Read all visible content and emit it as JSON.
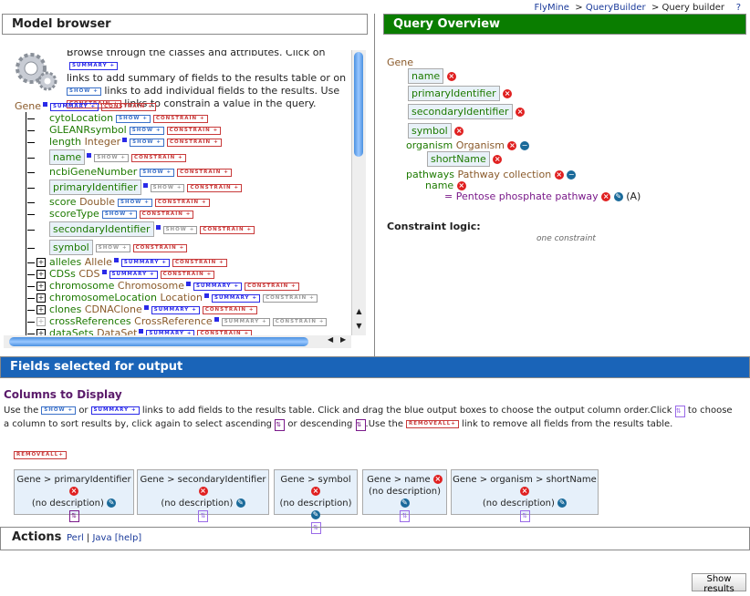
{
  "breadcrumb": {
    "items": [
      "FlyMine",
      "QueryBuilder",
      "Query builder"
    ],
    "sep": ">",
    "help": "?"
  },
  "model_browser": {
    "title": "Model browser",
    "intro": [
      "Browse through the classes and attributes. Click on",
      "links to add summary of fields to the results table or on",
      "links to add individual fields to the results. Use",
      "links to constrain a value in the query."
    ],
    "root": "Gene",
    "badges": {
      "summary": "SUMMARY +",
      "show": "SHOW +",
      "constrain": "CONSTRAIN +"
    },
    "items": [
      {
        "name": "cytoLocation",
        "type": "",
        "info": false,
        "boxed": false,
        "link": "show",
        "state": "on",
        "con": "on",
        "exp": ""
      },
      {
        "name": "GLEANRsymbol",
        "type": "",
        "info": false,
        "boxed": false,
        "link": "show",
        "state": "on",
        "con": "on",
        "exp": ""
      },
      {
        "name": "length",
        "type": "Integer",
        "info": true,
        "boxed": false,
        "link": "show",
        "state": "on",
        "con": "on",
        "exp": ""
      },
      {
        "name": "name",
        "type": "",
        "info": true,
        "boxed": true,
        "link": "show",
        "state": "off",
        "con": "on",
        "exp": ""
      },
      {
        "name": "ncbiGeneNumber",
        "type": "",
        "info": false,
        "boxed": false,
        "link": "show",
        "state": "on",
        "con": "on",
        "exp": ""
      },
      {
        "name": "primaryIdentifier",
        "type": "",
        "info": true,
        "boxed": true,
        "link": "show",
        "state": "off",
        "con": "on",
        "exp": ""
      },
      {
        "name": "score",
        "type": "Double",
        "info": false,
        "boxed": false,
        "link": "show",
        "state": "on",
        "con": "on",
        "exp": ""
      },
      {
        "name": "scoreType",
        "type": "",
        "info": false,
        "boxed": false,
        "link": "show",
        "state": "on",
        "con": "on",
        "exp": ""
      },
      {
        "name": "secondaryIdentifier",
        "type": "",
        "info": true,
        "boxed": true,
        "link": "show",
        "state": "off",
        "con": "on",
        "exp": ""
      },
      {
        "name": "symbol",
        "type": "",
        "info": false,
        "boxed": true,
        "link": "show",
        "state": "off",
        "con": "on",
        "exp": ""
      },
      {
        "name": "alleles",
        "type": "Allele",
        "info": true,
        "boxed": false,
        "link": "summary",
        "state": "on",
        "con": "on",
        "exp": "+"
      },
      {
        "name": "CDSs",
        "type": "CDS",
        "info": true,
        "boxed": false,
        "link": "summary",
        "state": "on",
        "con": "on",
        "exp": "+"
      },
      {
        "name": "chromosome",
        "type": "Chromosome",
        "info": true,
        "boxed": false,
        "link": "summary",
        "state": "on",
        "con": "on",
        "exp": "+"
      },
      {
        "name": "chromosomeLocation",
        "type": "Location",
        "info": true,
        "boxed": false,
        "link": "summary",
        "state": "on",
        "con": "off",
        "exp": "+"
      },
      {
        "name": "clones",
        "type": "CDNAClone",
        "info": true,
        "boxed": false,
        "link": "summary",
        "state": "on",
        "con": "on",
        "exp": "+"
      },
      {
        "name": "crossReferences",
        "type": "CrossReference",
        "info": true,
        "boxed": false,
        "link": "summary",
        "state": "off",
        "con": "off",
        "exp": "+"
      },
      {
        "name": "dataSets",
        "type": "DataSet",
        "info": true,
        "boxed": false,
        "link": "summary",
        "state": "on",
        "con": "on",
        "exp": "+"
      }
    ]
  },
  "query_overview": {
    "title": "Query Overview",
    "root": "Gene",
    "fields": [
      "name",
      "primaryIdentifier",
      "secondaryIdentifier",
      "symbol"
    ],
    "organism": {
      "name": "organism",
      "type": "Organism",
      "field": "shortName"
    },
    "pathways": {
      "name": "pathways",
      "type": "Pathway collection",
      "field": "name",
      "constraint": "= Pentose phosphate pathway",
      "code": "(A)"
    },
    "logic_label": "Constraint logic:",
    "logic_value": "one constraint"
  },
  "fields_output": {
    "title": "Fields selected for output",
    "subtitle": "Columns to Display",
    "help": [
      "Use the",
      "or",
      "links to add fields to the results table. Click and drag the blue output boxes to choose the output column order.Click",
      "to choose a column to sort results by, click again to select ascending",
      "or descending",
      ".Use the",
      "link to remove all fields from the results table."
    ],
    "remove_all": "REMOVEALL+",
    "columns": [
      {
        "path": "Gene > primaryIdentifier",
        "desc": "(no description)",
        "sorted": true
      },
      {
        "path": "Gene > secondaryIdentifier",
        "desc": "(no description)",
        "sorted": false
      },
      {
        "path": "Gene > symbol",
        "desc": "(no description)",
        "sorted": false
      },
      {
        "path": "Gene > name",
        "desc": "(no description)",
        "sorted": false
      },
      {
        "path": "Gene > organism > shortName",
        "desc": "(no description)",
        "sorted": false
      }
    ]
  },
  "actions": {
    "title": "Actions",
    "perl": "Perl",
    "sep": "|",
    "java": "Java",
    "help": "[help]"
  },
  "show_results": "Show results"
}
